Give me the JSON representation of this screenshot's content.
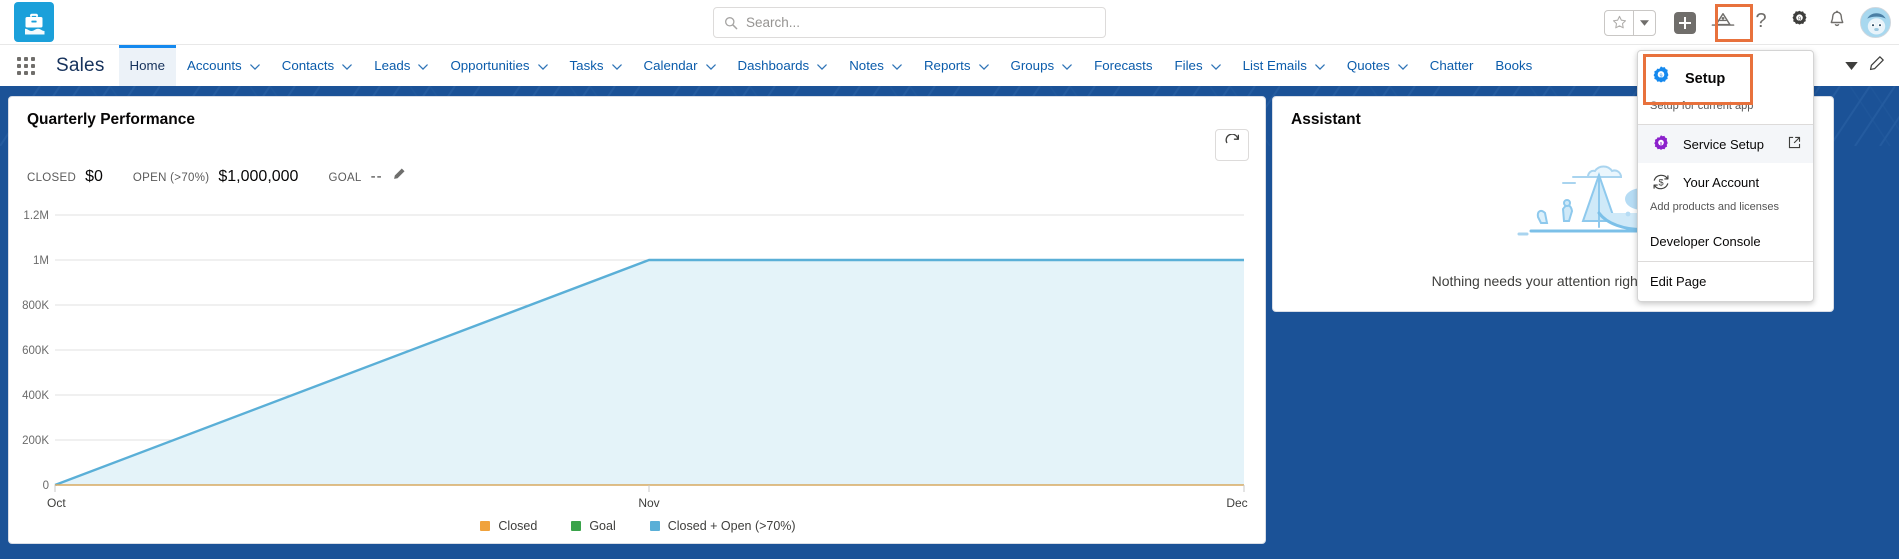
{
  "topbar": {
    "logo_icon": "briefcase-logo-icon",
    "search": {
      "placeholder": "Search...",
      "value": "",
      "icon": "search-icon"
    },
    "icons": [
      {
        "name": "favorites-star-icon",
        "glyph": "star"
      },
      {
        "name": "favorites-dropdown-icon",
        "glyph": "caret-down"
      },
      {
        "name": "global-actions-plus-icon",
        "glyph": "plus"
      },
      {
        "name": "trailhead-icon",
        "glyph": "mountain"
      },
      {
        "name": "help-icon",
        "glyph": "question"
      },
      {
        "name": "setup-gear-icon",
        "glyph": "gear"
      },
      {
        "name": "notifications-bell-icon",
        "glyph": "bell"
      },
      {
        "name": "user-avatar",
        "glyph": "avatar"
      }
    ],
    "highlight_color": "#e8713c"
  },
  "nav": {
    "app_launcher_icon": "app-launcher-waffle-icon",
    "app_name": "Sales",
    "items": [
      {
        "label": "Home",
        "active": true,
        "has_menu": false
      },
      {
        "label": "Accounts",
        "active": false,
        "has_menu": true
      },
      {
        "label": "Contacts",
        "active": false,
        "has_menu": true
      },
      {
        "label": "Leads",
        "active": false,
        "has_menu": true
      },
      {
        "label": "Opportunities",
        "active": false,
        "has_menu": true
      },
      {
        "label": "Tasks",
        "active": false,
        "has_menu": true
      },
      {
        "label": "Calendar",
        "active": false,
        "has_menu": true
      },
      {
        "label": "Dashboards",
        "active": false,
        "has_menu": true
      },
      {
        "label": "Notes",
        "active": false,
        "has_menu": true
      },
      {
        "label": "Reports",
        "active": false,
        "has_menu": true
      },
      {
        "label": "Groups",
        "active": false,
        "has_menu": true
      },
      {
        "label": "Forecasts",
        "active": false,
        "has_menu": false
      },
      {
        "label": "Files",
        "active": false,
        "has_menu": true
      },
      {
        "label": "List Emails",
        "active": false,
        "has_menu": true
      },
      {
        "label": "Quotes",
        "active": false,
        "has_menu": true
      },
      {
        "label": "Chatter",
        "active": false,
        "has_menu": false
      },
      {
        "label": "Books",
        "active": false,
        "has_menu": false
      }
    ],
    "more_icon": "nav-more-caret-icon",
    "edit_icon": "edit-page-pencil-icon"
  },
  "performance_card": {
    "title": "Quarterly Performance",
    "refresh_icon": "refresh-icon",
    "metrics": [
      {
        "key": "CLOSED",
        "value": "$0"
      },
      {
        "key": "OPEN (>70%)",
        "value": "$1,000,000"
      },
      {
        "key": "GOAL",
        "value": "--",
        "edit_icon": "goal-edit-pencil-icon"
      }
    ]
  },
  "chart_data": {
    "type": "area",
    "title": "Quarterly Performance",
    "x": [
      "Oct",
      "Nov",
      "Dec"
    ],
    "xlabel": "",
    "ylabel": "",
    "ylim": [
      0,
      1200000
    ],
    "ytick_labels": [
      "0",
      "200K",
      "400K",
      "600K",
      "800K",
      "1M",
      "1.2M"
    ],
    "ytick_values": [
      0,
      200000,
      400000,
      600000,
      800000,
      1000000,
      1200000
    ],
    "grid": true,
    "legend_position": "bottom",
    "series": [
      {
        "name": "Closed",
        "color": "#f0a23c",
        "values": [
          0,
          0,
          0
        ]
      },
      {
        "name": "Goal",
        "color": "#3aa34a",
        "values": [
          null,
          null,
          null
        ]
      },
      {
        "name": "Closed + Open (>70%)",
        "color": "#5aafd7",
        "values": [
          0,
          1000000,
          1000000
        ]
      }
    ],
    "legend": [
      "Closed",
      "Goal",
      "Closed + Open (>70%)"
    ]
  },
  "assistant_card": {
    "title": "Assistant",
    "empty_message": "Nothing needs your attention right now.",
    "illustration": "hammock-trees-sleep-illustration"
  },
  "setup_menu": {
    "setup": {
      "label": "Setup",
      "subtitle": "Setup for current app",
      "icon": "setup-gear-blue-icon",
      "highlighted": true
    },
    "items": [
      {
        "label": "Service Setup",
        "icon": "service-setup-gear-purple-icon",
        "external": true,
        "subtitle": null,
        "highlighted": true
      },
      {
        "label": "Your Account",
        "icon": "your-account-dollar-icon",
        "external": false,
        "subtitle": "Add products and licenses",
        "highlighted": false
      },
      {
        "label": "Developer Console",
        "icon": null,
        "external": false,
        "subtitle": null,
        "highlighted": false
      },
      {
        "label": "Edit Page",
        "icon": null,
        "external": false,
        "subtitle": null,
        "highlighted": false
      }
    ]
  },
  "colors": {
    "brand_blue": "#1b5297",
    "link_blue": "#0b5cab",
    "active_tab": "#1589ee",
    "highlight_orange": "#e8713c",
    "series_closed": "#f0a23c",
    "series_goal": "#3aa34a",
    "series_open": "#5aafd7"
  }
}
